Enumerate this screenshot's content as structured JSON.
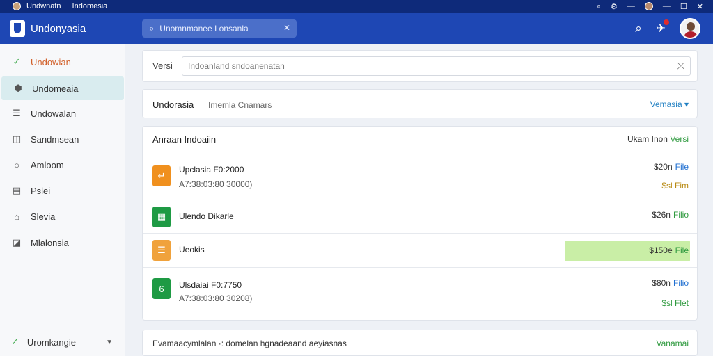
{
  "titlebar": {
    "title_left": "Undwnatn",
    "title_right": "Indomesia",
    "controls": [
      "search-icon",
      "settings-icon",
      "minimize-icon",
      "maximize-icon",
      "close-icon"
    ],
    "control_glyphs": [
      "⌕",
      "⚙",
      "—",
      "☐",
      "✕"
    ]
  },
  "header": {
    "brand": "Undonyasia",
    "search_text": "Unomnmanee I onsanla",
    "search_glyph": "⌕",
    "clear_glyph": "✕",
    "search_action_glyph": "⌕",
    "notify_glyph": "✈",
    "background": "#1e47b4"
  },
  "sidebar": {
    "items": [
      {
        "label": "Undowian",
        "icon": "check-circle-icon",
        "glyph": "✓"
      },
      {
        "label": "Undomeaia",
        "icon": "package-icon",
        "glyph": "⬢"
      },
      {
        "label": "Undowalan",
        "icon": "list-icon",
        "glyph": "☰"
      },
      {
        "label": "Sandmsean",
        "icon": "tag-icon",
        "glyph": "◫"
      },
      {
        "label": "Amloom",
        "icon": "circle-icon",
        "glyph": "○"
      },
      {
        "label": "Pslei",
        "icon": "chart-icon",
        "glyph": "▤"
      },
      {
        "label": "Slevia",
        "icon": "building-icon",
        "glyph": "⌂"
      },
      {
        "label": "Mlalonsia",
        "icon": "bookmark-icon",
        "glyph": "◪"
      }
    ],
    "footer": {
      "label": "Uromkangie",
      "glyph": "✓",
      "chevron": "▼"
    }
  },
  "filter": {
    "label": "Versi",
    "value": "Indoanland sndoanenatan",
    "clear_glyph": "⤫"
  },
  "selector": {
    "name": "Undorasia",
    "description": "Imemla Cnamars",
    "value": "Vemasia ▾"
  },
  "list": {
    "title": "Anraan Indoaiin",
    "col_label": "Ukam Inon",
    "col_accent": "Versi",
    "rows": [
      {
        "icon": "folder-icon",
        "glyph": "↵",
        "color": "#f0901e",
        "title": "Upclasia F0:2000",
        "subtitle": "A7:38:03:80 30000)",
        "price": "$20n",
        "tag": "File",
        "extra": "$sl Fim"
      },
      {
        "icon": "spreadsheet-icon",
        "glyph": "▦",
        "color": "#1e9a44",
        "title": "Ulendo Dikarle",
        "subtitle": "",
        "price": "$26n",
        "tag": "Filio",
        "extra": ""
      },
      {
        "icon": "document-icon",
        "glyph": "☰",
        "color": "#f0a23c",
        "title": "Ueokis",
        "subtitle": "",
        "price": "$150e",
        "tag": "File",
        "extra": ""
      },
      {
        "icon": "app-icon",
        "glyph": "6",
        "color": "#1e9a44",
        "title": "Ulsdaiai F0:7750",
        "subtitle": "A7:38:03:80 30208)",
        "price": "$80n",
        "tag": "Filio",
        "extra": "$sl Flet"
      }
    ]
  },
  "footer_bar": {
    "text": "Evamaacymlalan  ·: domelan hgnadeaand aeyiasnas",
    "action": "Vanamai"
  }
}
